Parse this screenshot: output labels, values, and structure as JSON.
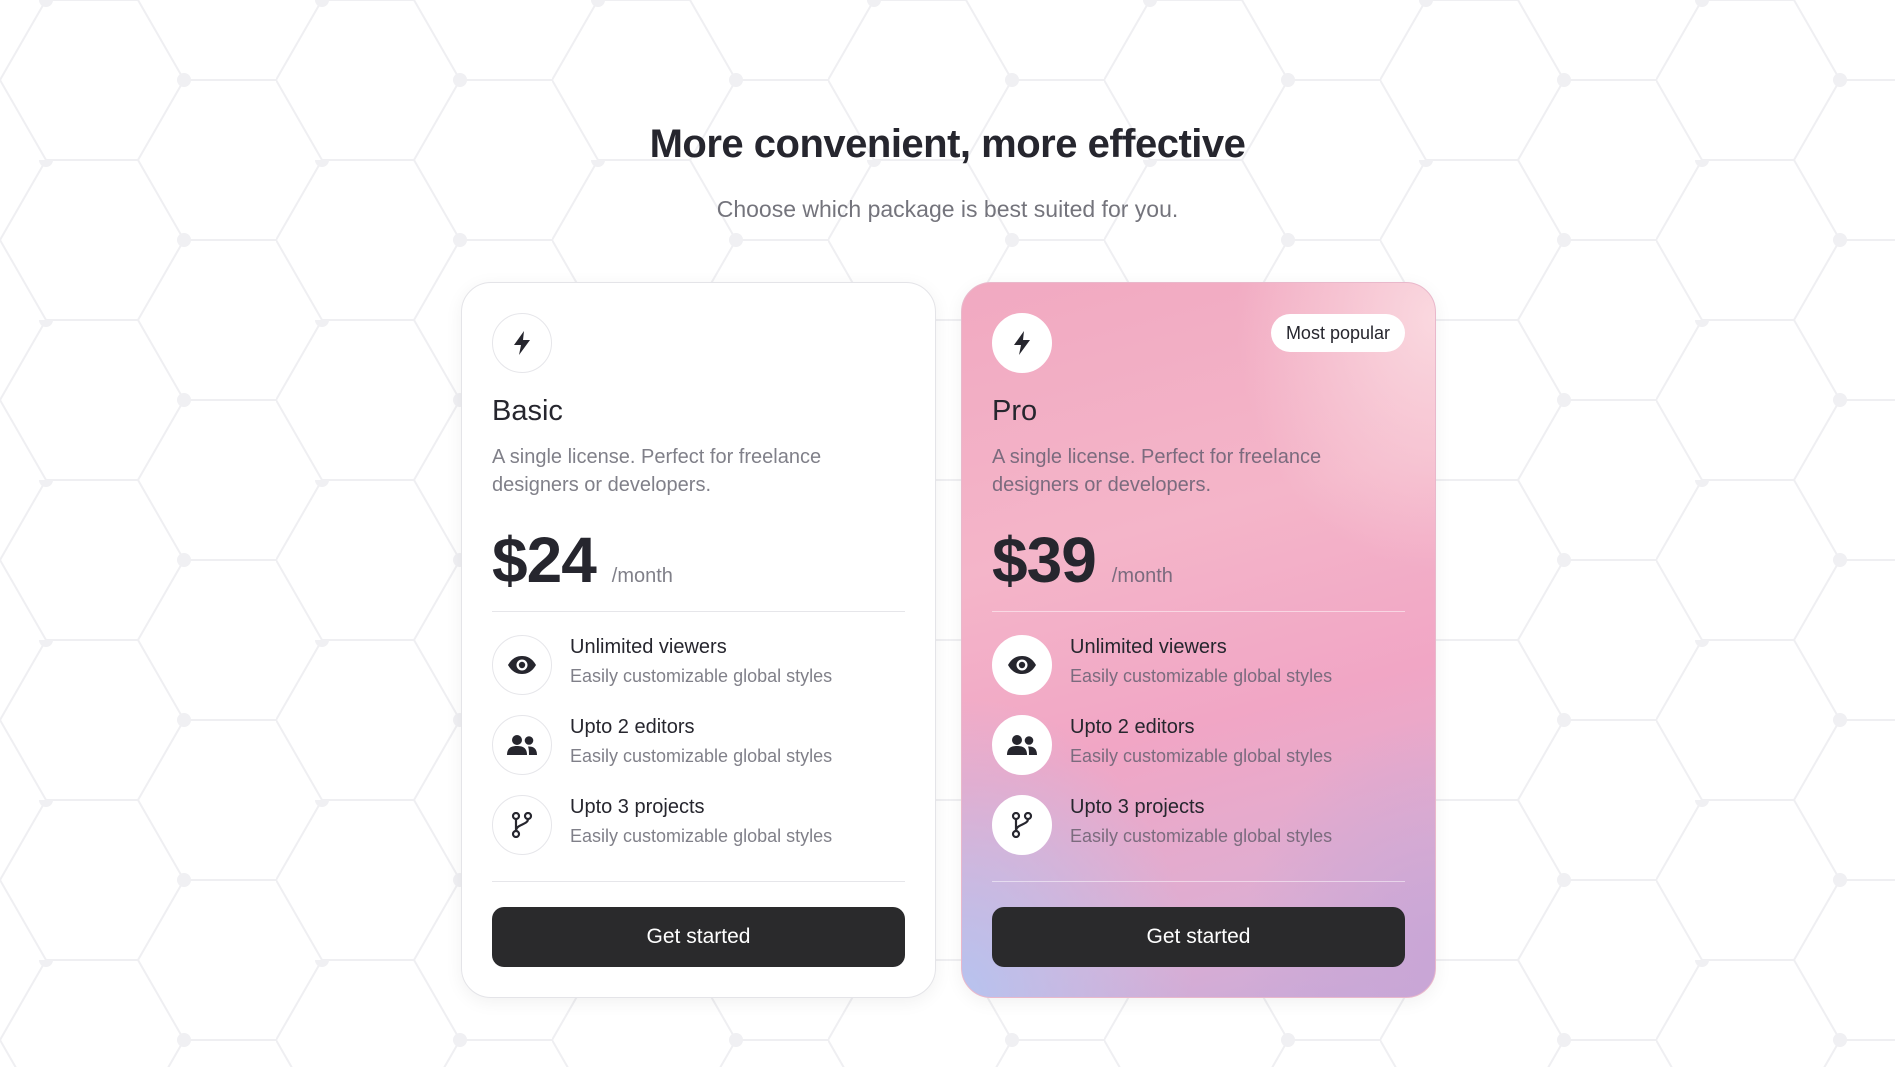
{
  "header": {
    "title": "More convenient, more effective",
    "subtitle": "Choose which package is best suited for you."
  },
  "plans": [
    {
      "name": "Basic",
      "icon": "lightning-bolt-icon",
      "description": "A single license. Perfect for freelance designers or developers.",
      "price": "$24",
      "period": "/month",
      "badge": "",
      "features": [
        {
          "icon": "eye-icon",
          "title": "Unlimited viewers",
          "subtitle": "Easily customizable global styles"
        },
        {
          "icon": "users-icon",
          "title": "Upto 2 editors",
          "subtitle": "Easily customizable global styles"
        },
        {
          "icon": "git-branch-icon",
          "title": "Upto 3 projects",
          "subtitle": "Easily customizable global styles"
        }
      ],
      "cta": "Get started"
    },
    {
      "name": "Pro",
      "icon": "lightning-bolt-icon",
      "description": "A single license. Perfect for freelance designers or developers.",
      "price": "$39",
      "period": "/month",
      "badge": "Most popular",
      "features": [
        {
          "icon": "eye-icon",
          "title": "Unlimited viewers",
          "subtitle": "Easily customizable global styles"
        },
        {
          "icon": "users-icon",
          "title": "Upto 2 editors",
          "subtitle": "Easily customizable global styles"
        },
        {
          "icon": "git-branch-icon",
          "title": "Upto 3 projects",
          "subtitle": "Easily customizable global styles"
        }
      ],
      "cta": "Get started"
    }
  ],
  "colors": {
    "button": "#2a2a2c",
    "pro_gradient_start": "#f1a9c1",
    "pro_gradient_end": "#b7c3ef"
  }
}
